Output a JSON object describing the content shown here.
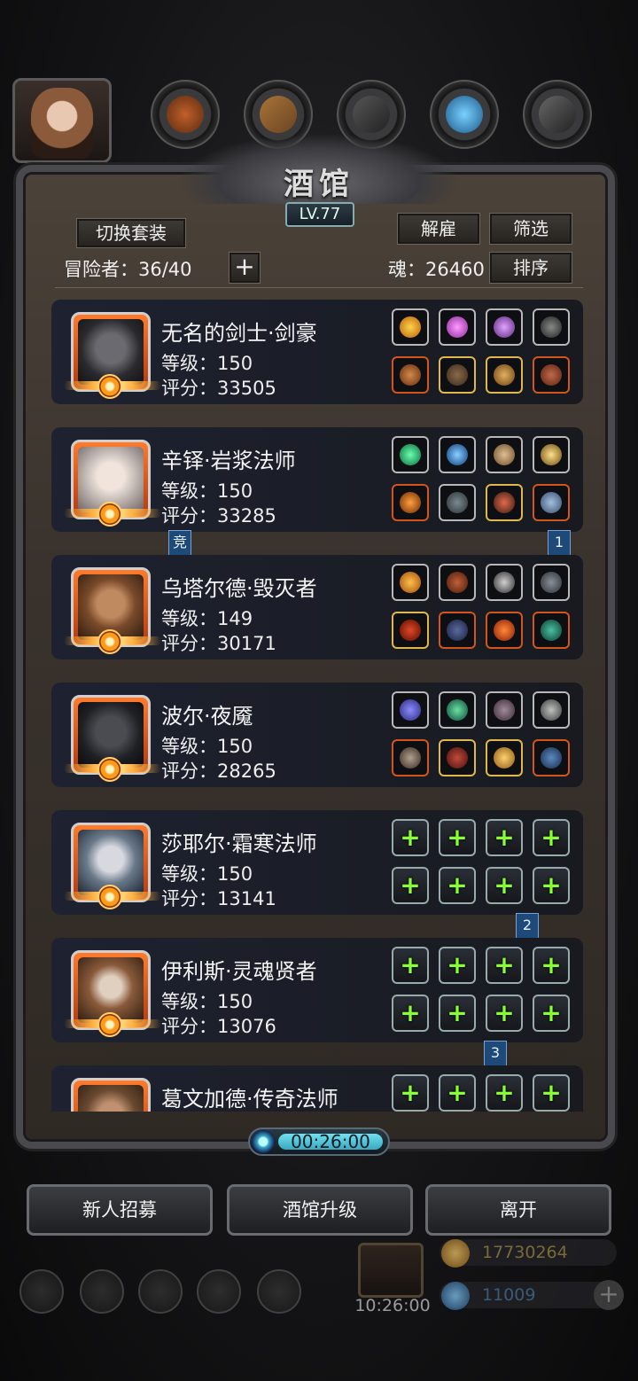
{
  "tavern": {
    "title": "酒馆",
    "level": "LV.77",
    "switch_outfit_label": "切换套装",
    "dismiss_label": "解雇",
    "filter_label": "筛选",
    "sort_label": "排序",
    "adventurer_label": "冒险者：36/40",
    "soul_label": "魂：26460",
    "add_icon": "plus-icon"
  },
  "heroes": [
    {
      "name": "无名的剑士·剑豪",
      "level": "等级：150",
      "score": "评分：33505",
      "face_color": "#3a3a3e"
    },
    {
      "name": "辛铎·岩浆法师",
      "level": "等级：150",
      "score": "评分：33285",
      "face_color": "#d8d0cc"
    },
    {
      "name": "乌塔尔德·毁灭者",
      "level": "等级：149",
      "score": "评分：30171",
      "face_color": "#8a5a3a"
    },
    {
      "name": "波尔·夜魇",
      "level": "等级：150",
      "score": "评分：28265",
      "face_color": "#2a2c30"
    },
    {
      "name": "莎耶尔·霜寒法师",
      "level": "等级：150",
      "score": "评分：13141",
      "face_color": "#8a9aa8"
    },
    {
      "name": "伊利斯·灵魂贤者",
      "level": "等级：150",
      "score": "评分：13076",
      "face_color": "#7a5a40"
    },
    {
      "name": "葛文加德·传奇法师",
      "level": "",
      "score": "",
      "face_color": "#6a4a30"
    }
  ],
  "tags": {
    "rank_badge": "竞",
    "team_1": "1",
    "team_2": "2",
    "team_3": "3"
  },
  "timer": {
    "value": "00:26:00",
    "icon": "clock-icon"
  },
  "actions": {
    "recruit_label": "新人招募",
    "upgrade_label": "酒馆升级",
    "leave_label": "离开"
  },
  "hud": {
    "gift_timer": "10:26:00",
    "gold": "17730264",
    "gems": "11009",
    "add_icon": "plus-icon"
  },
  "colors": {
    "accent_green": "#88ff33",
    "frame": "#4a4a4e",
    "tag_blue": "#1e4a7a"
  }
}
